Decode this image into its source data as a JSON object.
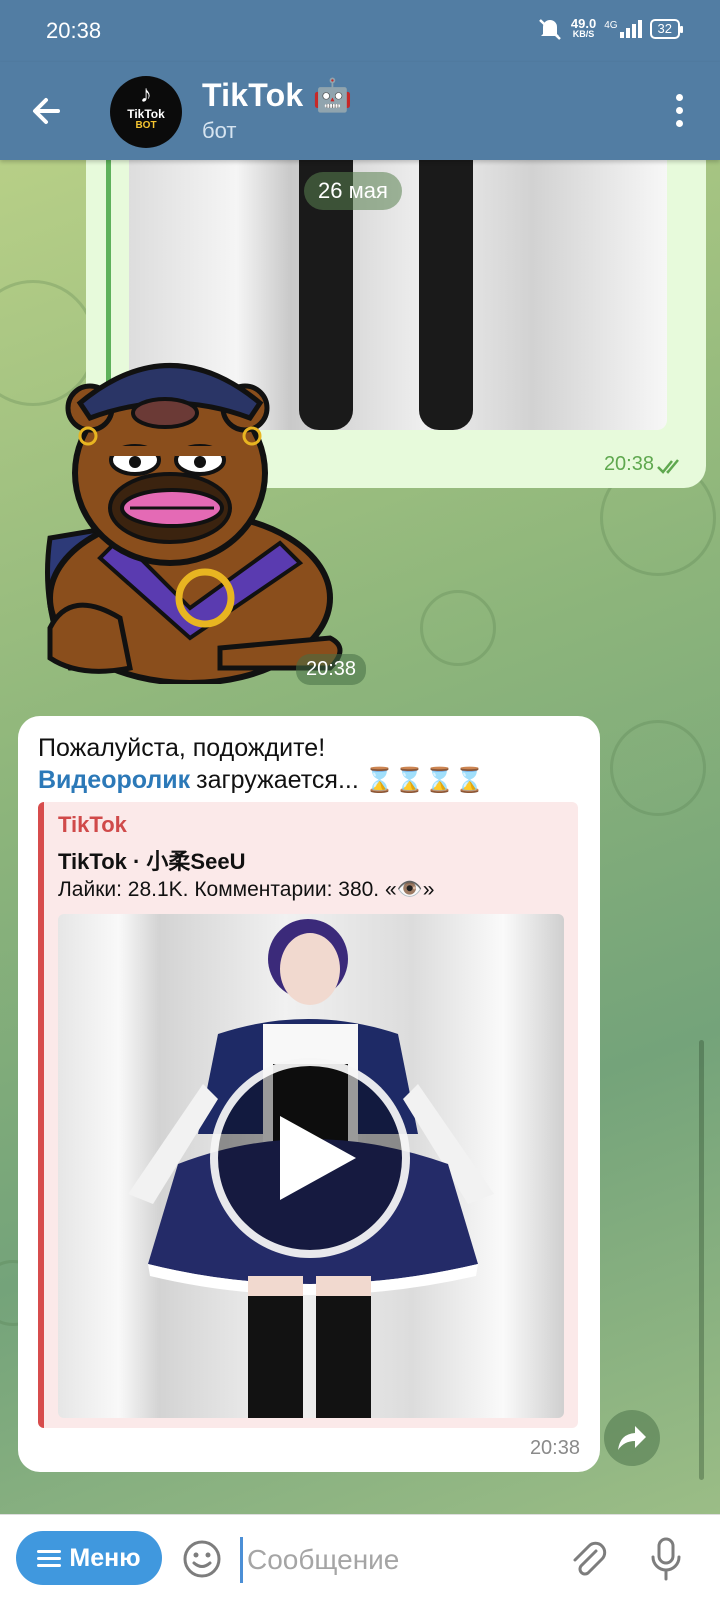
{
  "status_bar": {
    "time": "20:38",
    "net_speed": "49.0",
    "net_speed_unit": "KB/S",
    "network": "4G",
    "battery": "32"
  },
  "header": {
    "title": "TikTok 🤖",
    "subtitle": "бот",
    "avatar": {
      "line1": "TikTok",
      "line2": "BOT"
    }
  },
  "chat": {
    "date_label": "26 мая",
    "outgoing": {
      "time": "20:38",
      "status": "read"
    },
    "sticker": {
      "time": "20:38"
    },
    "incoming": {
      "line1": "Пожалуйста, подождите!",
      "link_text": "Видеоролик",
      "line2_rest": "загружается...",
      "hourglasses": "⌛⌛⌛⌛",
      "preview": {
        "site": "TikTok",
        "title": "TikTok · 小柔SeeU",
        "description": "Лайки: 28.1K. Комментарии: 380. «👁️»"
      },
      "time": "20:38"
    }
  },
  "input_bar": {
    "menu_label": "Меню",
    "placeholder": "Сообщение"
  },
  "colors": {
    "header": "#527da3",
    "accent": "#4098de",
    "link": "#2c79b8",
    "preview_accent": "#d74c4c"
  }
}
